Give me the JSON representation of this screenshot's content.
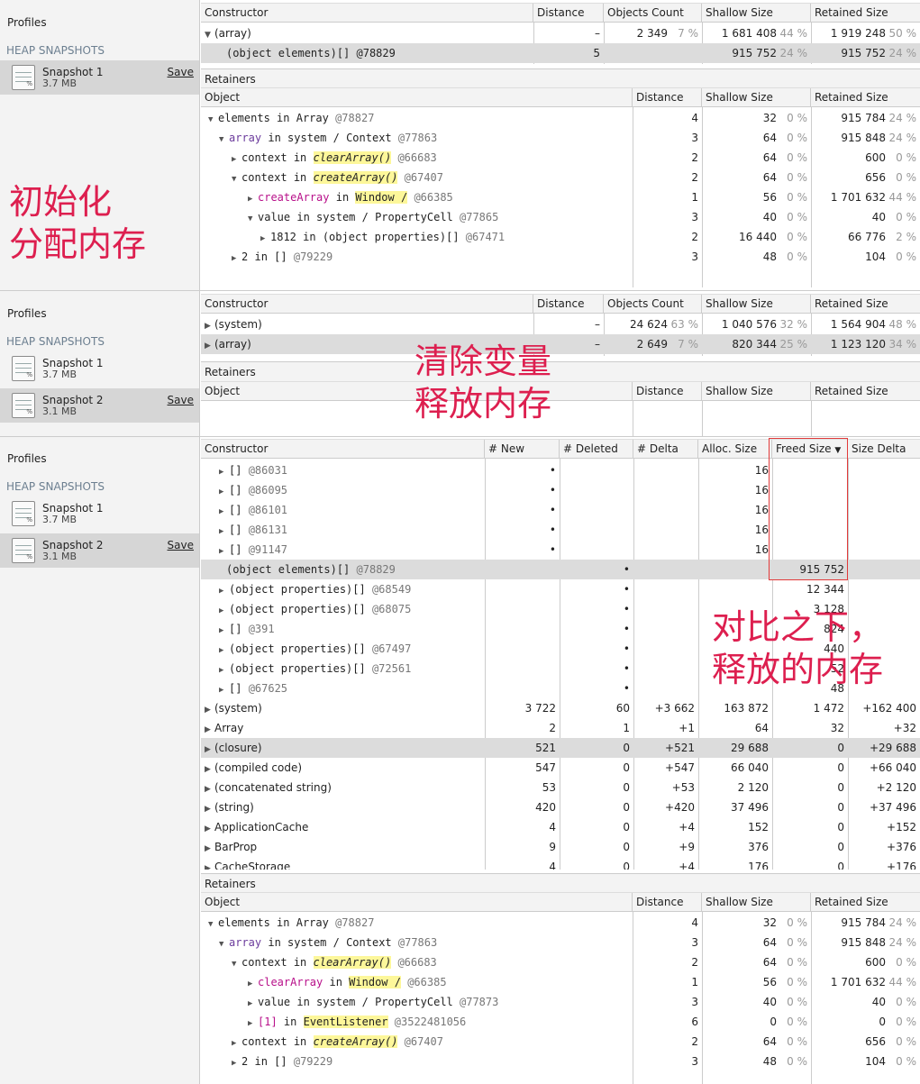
{
  "sidebar": {
    "profiles_label": "Profiles",
    "heap_label": "HEAP SNAPSHOTS",
    "save_label": "Save",
    "snapshot1": {
      "name": "Snapshot 1",
      "size": "3.7 MB"
    },
    "snapshot2": {
      "name": "Snapshot 2",
      "size": "3.1 MB"
    }
  },
  "headers": {
    "constructor": "Constructor",
    "distance": "Distance",
    "objects_count": "Objects Count",
    "shallow_size": "Shallow Size",
    "retained_size": "Retained Size",
    "retainers": "Retainers",
    "object": "Object",
    "new": "# New",
    "deleted": "# Deleted",
    "delta": "# Delta",
    "alloc_size": "Alloc. Size",
    "freed_size": "Freed Size",
    "size_delta": "Size Delta"
  },
  "panel1": {
    "rows": [
      {
        "name": "(array)",
        "distance": "–",
        "count": "2 349",
        "count_pct": "7 %",
        "shallow": "1 681 408",
        "shallow_pct": "44 %",
        "retained": "1 919 248",
        "retained_pct": "50 %"
      },
      {
        "name": "(object elements)[] @78829",
        "distance": "5",
        "count": "",
        "count_pct": "",
        "shallow": "915 752",
        "shallow_pct": "24 %",
        "retained": "915 752",
        "retained_pct": "24 %"
      }
    ],
    "retainers": [
      {
        "w1": "elements",
        "w2": "in",
        "w3": "Array",
        "id": "@78827",
        "distance": "4",
        "shallow": "32",
        "shallow_pct": "0 %",
        "retained": "915 784",
        "retained_pct": "24 %"
      },
      {
        "w1": "array",
        "w2": "in",
        "w3": "system / Context",
        "id": "@77863",
        "distance": "3",
        "shallow": "64",
        "shallow_pct": "0 %",
        "retained": "915 848",
        "retained_pct": "24 %"
      },
      {
        "w1": "context",
        "w2": "in",
        "w3": "clearArray()",
        "id": "@66683",
        "distance": "2",
        "shallow": "64",
        "shallow_pct": "0 %",
        "retained": "600",
        "retained_pct": "0 %"
      },
      {
        "w1": "context",
        "w2": "in",
        "w3": "createArray()",
        "id": "@67407",
        "distance": "2",
        "shallow": "64",
        "shallow_pct": "0 %",
        "retained": "656",
        "retained_pct": "0 %"
      },
      {
        "w1": "createArray",
        "w2": "in",
        "w3": "Window /",
        "id": "@66385",
        "distance": "1",
        "shallow": "56",
        "shallow_pct": "0 %",
        "retained": "1 701 632",
        "retained_pct": "44 %"
      },
      {
        "w1": "value",
        "w2": "in",
        "w3": "system / PropertyCell",
        "id": "@77865",
        "distance": "3",
        "shallow": "40",
        "shallow_pct": "0 %",
        "retained": "40",
        "retained_pct": "0 %"
      },
      {
        "w1": "1812",
        "w2": "in",
        "w3": "(object properties)[]",
        "id": "@67471",
        "distance": "2",
        "shallow": "16 440",
        "shallow_pct": "0 %",
        "retained": "66 776",
        "retained_pct": "2 %"
      },
      {
        "w1": "2",
        "w2": "in",
        "w3": "[]",
        "id": "@79229",
        "distance": "3",
        "shallow": "48",
        "shallow_pct": "0 %",
        "retained": "104",
        "retained_pct": "0 %"
      }
    ]
  },
  "panel2": {
    "rows": [
      {
        "name": "(system)",
        "distance": "–",
        "count": "24 624",
        "count_pct": "63 %",
        "shallow": "1 040 576",
        "shallow_pct": "32 %",
        "retained": "1 564 904",
        "retained_pct": "48 %"
      },
      {
        "name": "(array)",
        "distance": "–",
        "count": "2 649",
        "count_pct": "7 %",
        "shallow": "820 344",
        "shallow_pct": "25 %",
        "retained": "1 123 120",
        "retained_pct": "34 %"
      }
    ]
  },
  "panel3": {
    "items": [
      {
        "name": "[]",
        "id": "@86031",
        "new": "•",
        "deleted": "",
        "alloc": "16",
        "freed": ""
      },
      {
        "name": "[]",
        "id": "@86095",
        "new": "•",
        "deleted": "",
        "alloc": "16",
        "freed": ""
      },
      {
        "name": "[]",
        "id": "@86101",
        "new": "•",
        "deleted": "",
        "alloc": "16",
        "freed": ""
      },
      {
        "name": "[]",
        "id": "@86131",
        "new": "•",
        "deleted": "",
        "alloc": "16",
        "freed": ""
      },
      {
        "name": "[]",
        "id": "@91147",
        "new": "•",
        "deleted": "",
        "alloc": "16",
        "freed": ""
      },
      {
        "name": "(object elements)[]",
        "id": "@78829",
        "new": "",
        "deleted": "•",
        "alloc": "",
        "freed": "915 752"
      },
      {
        "name": "(object properties)[]",
        "id": "@68549",
        "new": "",
        "deleted": "•",
        "alloc": "",
        "freed": "12 344"
      },
      {
        "name": "(object properties)[]",
        "id": "@68075",
        "new": "",
        "deleted": "•",
        "alloc": "",
        "freed": "3 128"
      },
      {
        "name": "[]",
        "id": "@391",
        "new": "",
        "deleted": "•",
        "alloc": "",
        "freed": "824"
      },
      {
        "name": "(object properties)[]",
        "id": "@67497",
        "new": "",
        "deleted": "•",
        "alloc": "",
        "freed": "440"
      },
      {
        "name": "(object properties)[]",
        "id": "@72561",
        "new": "",
        "deleted": "•",
        "alloc": "",
        "freed": "52"
      },
      {
        "name": "[]",
        "id": "@67625",
        "new": "",
        "deleted": "•",
        "alloc": "",
        "freed": "48"
      }
    ],
    "groups": [
      {
        "name": "(system)",
        "new": "3 722",
        "deleted": "60",
        "delta": "+3 662",
        "alloc": "163 872",
        "freed": "1 472",
        "size_delta": "+162 400"
      },
      {
        "name": "Array",
        "new": "2",
        "deleted": "1",
        "delta": "+1",
        "alloc": "64",
        "freed": "32",
        "size_delta": "+32"
      },
      {
        "name": "(closure)",
        "new": "521",
        "deleted": "0",
        "delta": "+521",
        "alloc": "29 688",
        "freed": "0",
        "size_delta": "+29 688"
      },
      {
        "name": "(compiled code)",
        "new": "547",
        "deleted": "0",
        "delta": "+547",
        "alloc": "66 040",
        "freed": "0",
        "size_delta": "+66 040"
      },
      {
        "name": "(concatenated string)",
        "new": "53",
        "deleted": "0",
        "delta": "+53",
        "alloc": "2 120",
        "freed": "0",
        "size_delta": "+2 120"
      },
      {
        "name": "(string)",
        "new": "420",
        "deleted": "0",
        "delta": "+420",
        "alloc": "37 496",
        "freed": "0",
        "size_delta": "+37 496"
      },
      {
        "name": "ApplicationCache",
        "new": "4",
        "deleted": "0",
        "delta": "+4",
        "alloc": "152",
        "freed": "0",
        "size_delta": "+152"
      },
      {
        "name": "BarProp",
        "new": "9",
        "deleted": "0",
        "delta": "+9",
        "alloc": "376",
        "freed": "0",
        "size_delta": "+376"
      },
      {
        "name": "CacheStorage",
        "new": "4",
        "deleted": "0",
        "delta": "+4",
        "alloc": "176",
        "freed": "0",
        "size_delta": "+176"
      }
    ],
    "retainers": [
      {
        "w1": "elements",
        "w2": "in",
        "w3": "Array",
        "id": "@78827",
        "distance": "4",
        "shallow": "32",
        "shallow_pct": "0 %",
        "retained": "915 784",
        "retained_pct": "24 %"
      },
      {
        "w1": "array",
        "w2": "in",
        "w3": "system / Context",
        "id": "@77863",
        "distance": "3",
        "shallow": "64",
        "shallow_pct": "0 %",
        "retained": "915 848",
        "retained_pct": "24 %"
      },
      {
        "w1": "context",
        "w2": "in",
        "w3": "clearArray()",
        "id": "@66683",
        "distance": "2",
        "shallow": "64",
        "shallow_pct": "0 %",
        "retained": "600",
        "retained_pct": "0 %"
      },
      {
        "w1": "clearArray",
        "w2": "in",
        "w3": "Window /",
        "id": "@66385",
        "distance": "1",
        "shallow": "56",
        "shallow_pct": "0 %",
        "retained": "1 701 632",
        "retained_pct": "44 %"
      },
      {
        "w1": "value",
        "w2": "in",
        "w3": "system / PropertyCell",
        "id": "@77873",
        "distance": "3",
        "shallow": "40",
        "shallow_pct": "0 %",
        "retained": "40",
        "retained_pct": "0 %"
      },
      {
        "w1": "[1]",
        "w2": "in",
        "w3": "EventListener",
        "id": "@3522481056",
        "distance": "6",
        "shallow": "0",
        "shallow_pct": "0 %",
        "retained": "0",
        "retained_pct": "0 %"
      },
      {
        "w1": "context",
        "w2": "in",
        "w3": "createArray()",
        "id": "@67407",
        "distance": "2",
        "shallow": "64",
        "shallow_pct": "0 %",
        "retained": "656",
        "retained_pct": "0 %"
      },
      {
        "w1": "2",
        "w2": "in",
        "w3": "[]",
        "id": "@79229",
        "distance": "3",
        "shallow": "48",
        "shallow_pct": "0 %",
        "retained": "104",
        "retained_pct": "0 %"
      }
    ]
  },
  "annotations": {
    "a1_line1": "初始化",
    "a1_line2": "分配内存",
    "a2_line1": "清除变量",
    "a2_line2": "释放内存",
    "a3_line1": "对比之下，",
    "a3_line2": "释放的内存"
  },
  "icons": {
    "expanded": "▼",
    "collapsed": "▶",
    "sort_desc": "▼"
  },
  "colors": {
    "annotation": "#dd1f4f",
    "highlight": "#fdf79a",
    "selected_row": "#dcdcdc",
    "keyword": "#6b3b9c",
    "function": "#b8108a"
  }
}
